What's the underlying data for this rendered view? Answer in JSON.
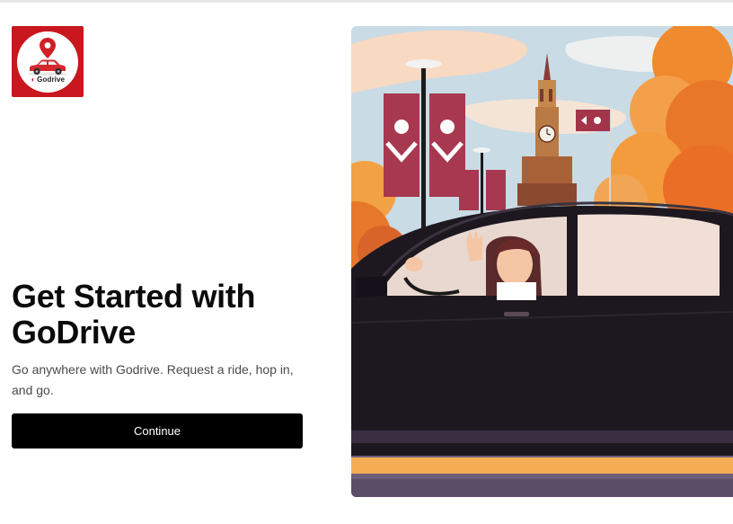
{
  "brand": {
    "logo_text": "Godrive",
    "colors": {
      "logo_background": "#c8171e",
      "pin": "#d01f26",
      "car": "#d22a2f"
    },
    "icons": [
      "map-pin-icon",
      "car-icon"
    ]
  },
  "intro": {
    "headline": "Get Started with GoDrive",
    "description": "Go anywhere with Godrive. Request a ride, hop in, and go."
  },
  "actions": {
    "continue_label": "Continue"
  },
  "colors": {
    "button_background": "#000000",
    "button_text": "#ffffff",
    "headline": "#0b0b0b",
    "body_text": "#4a4a4a"
  }
}
